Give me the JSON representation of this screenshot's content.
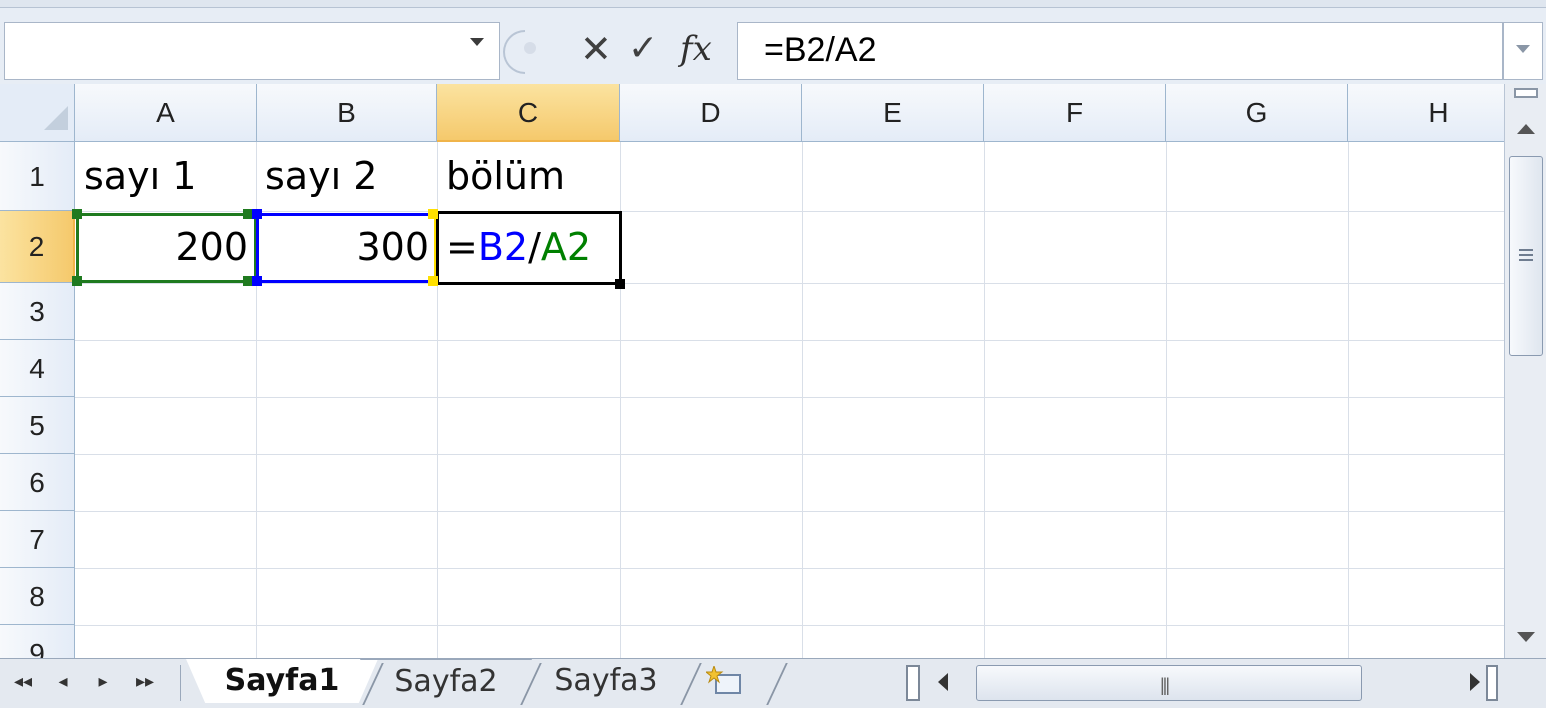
{
  "formula_bar": {
    "name_box_value": "",
    "cancel_icon": "✕",
    "enter_icon": "✓",
    "fx_icon": "fx",
    "formula": "=B2/A2"
  },
  "columns": [
    "A",
    "B",
    "C",
    "D",
    "E",
    "F",
    "G",
    "H"
  ],
  "active_column": "C",
  "rows": [
    "1",
    "2",
    "3",
    "4",
    "5",
    "6",
    "7",
    "8",
    "9"
  ],
  "active_row": "2",
  "cells": {
    "A1": "sayı 1",
    "B1": "sayı 2",
    "C1": "bölüm",
    "A2": "200",
    "B2": "300",
    "C2_prefix": "=",
    "C2_ref1": "B2",
    "C2_op": "/",
    "C2_ref2": "A2"
  },
  "colors": {
    "ref_b2": "#0000ff",
    "ref_a2": "#008000",
    "active_header": "#f5c96c"
  },
  "sheet_tabs": [
    {
      "label": "Sayfa1",
      "active": true
    },
    {
      "label": "Sayfa2",
      "active": false
    },
    {
      "label": "Sayfa3",
      "active": false
    }
  ],
  "tab_nav": [
    "◂◂",
    "◂",
    "▸",
    "▸▸"
  ],
  "icons": {
    "new_sheet": "insert-worksheet-icon",
    "hscroll_grip": "|||"
  }
}
